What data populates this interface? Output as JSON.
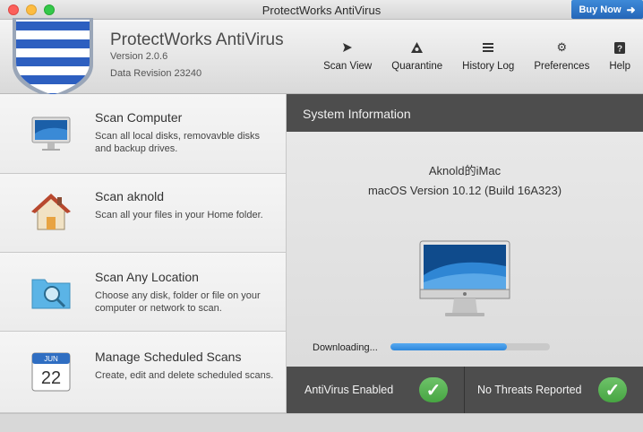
{
  "window": {
    "title": "ProtectWorks AntiVirus",
    "buy_now": "Buy Now"
  },
  "header": {
    "app_name": "ProtectWorks AntiVirus",
    "version": "Version 2.0.6",
    "revision": "Data Revision 23240"
  },
  "toolbar": {
    "items": [
      {
        "label": "Scan View",
        "icon": "play-arrow-icon"
      },
      {
        "label": "Quarantine",
        "icon": "biohazard-icon"
      },
      {
        "label": "History Log",
        "icon": "list-icon"
      },
      {
        "label": "Preferences",
        "icon": "gear-icon"
      },
      {
        "label": "Help",
        "icon": "question-icon"
      }
    ]
  },
  "scans": [
    {
      "title": "Scan Computer",
      "desc": "Scan all local disks, removavble disks and backup drives.",
      "icon": "imac-icon"
    },
    {
      "title": "Scan aknold",
      "desc": "Scan all your files in your Home folder.",
      "icon": "home-icon"
    },
    {
      "title": "Scan Any Location",
      "desc": "Choose any disk, folder or file on your computer or network to scan.",
      "icon": "folder-search-icon"
    },
    {
      "title": "Manage Scheduled Scans",
      "desc": "Create, edit and delete scheduled scans.",
      "icon": "calendar-icon",
      "cal_month": "JUN",
      "cal_day": "22"
    }
  ],
  "system": {
    "header": "System Information",
    "host": "Aknold的iMac",
    "os": "macOS Version 10.12 (Build 16A323)",
    "downloading_label": "Downloading...",
    "progress_fraction": 0.73
  },
  "status": {
    "antivirus": "AntiVirus Enabled",
    "threats": "No Threats Reported"
  },
  "colors": {
    "accent_blue": "#2466b8",
    "status_green": "#47a542",
    "dark_panel": "#4d4d4d"
  }
}
